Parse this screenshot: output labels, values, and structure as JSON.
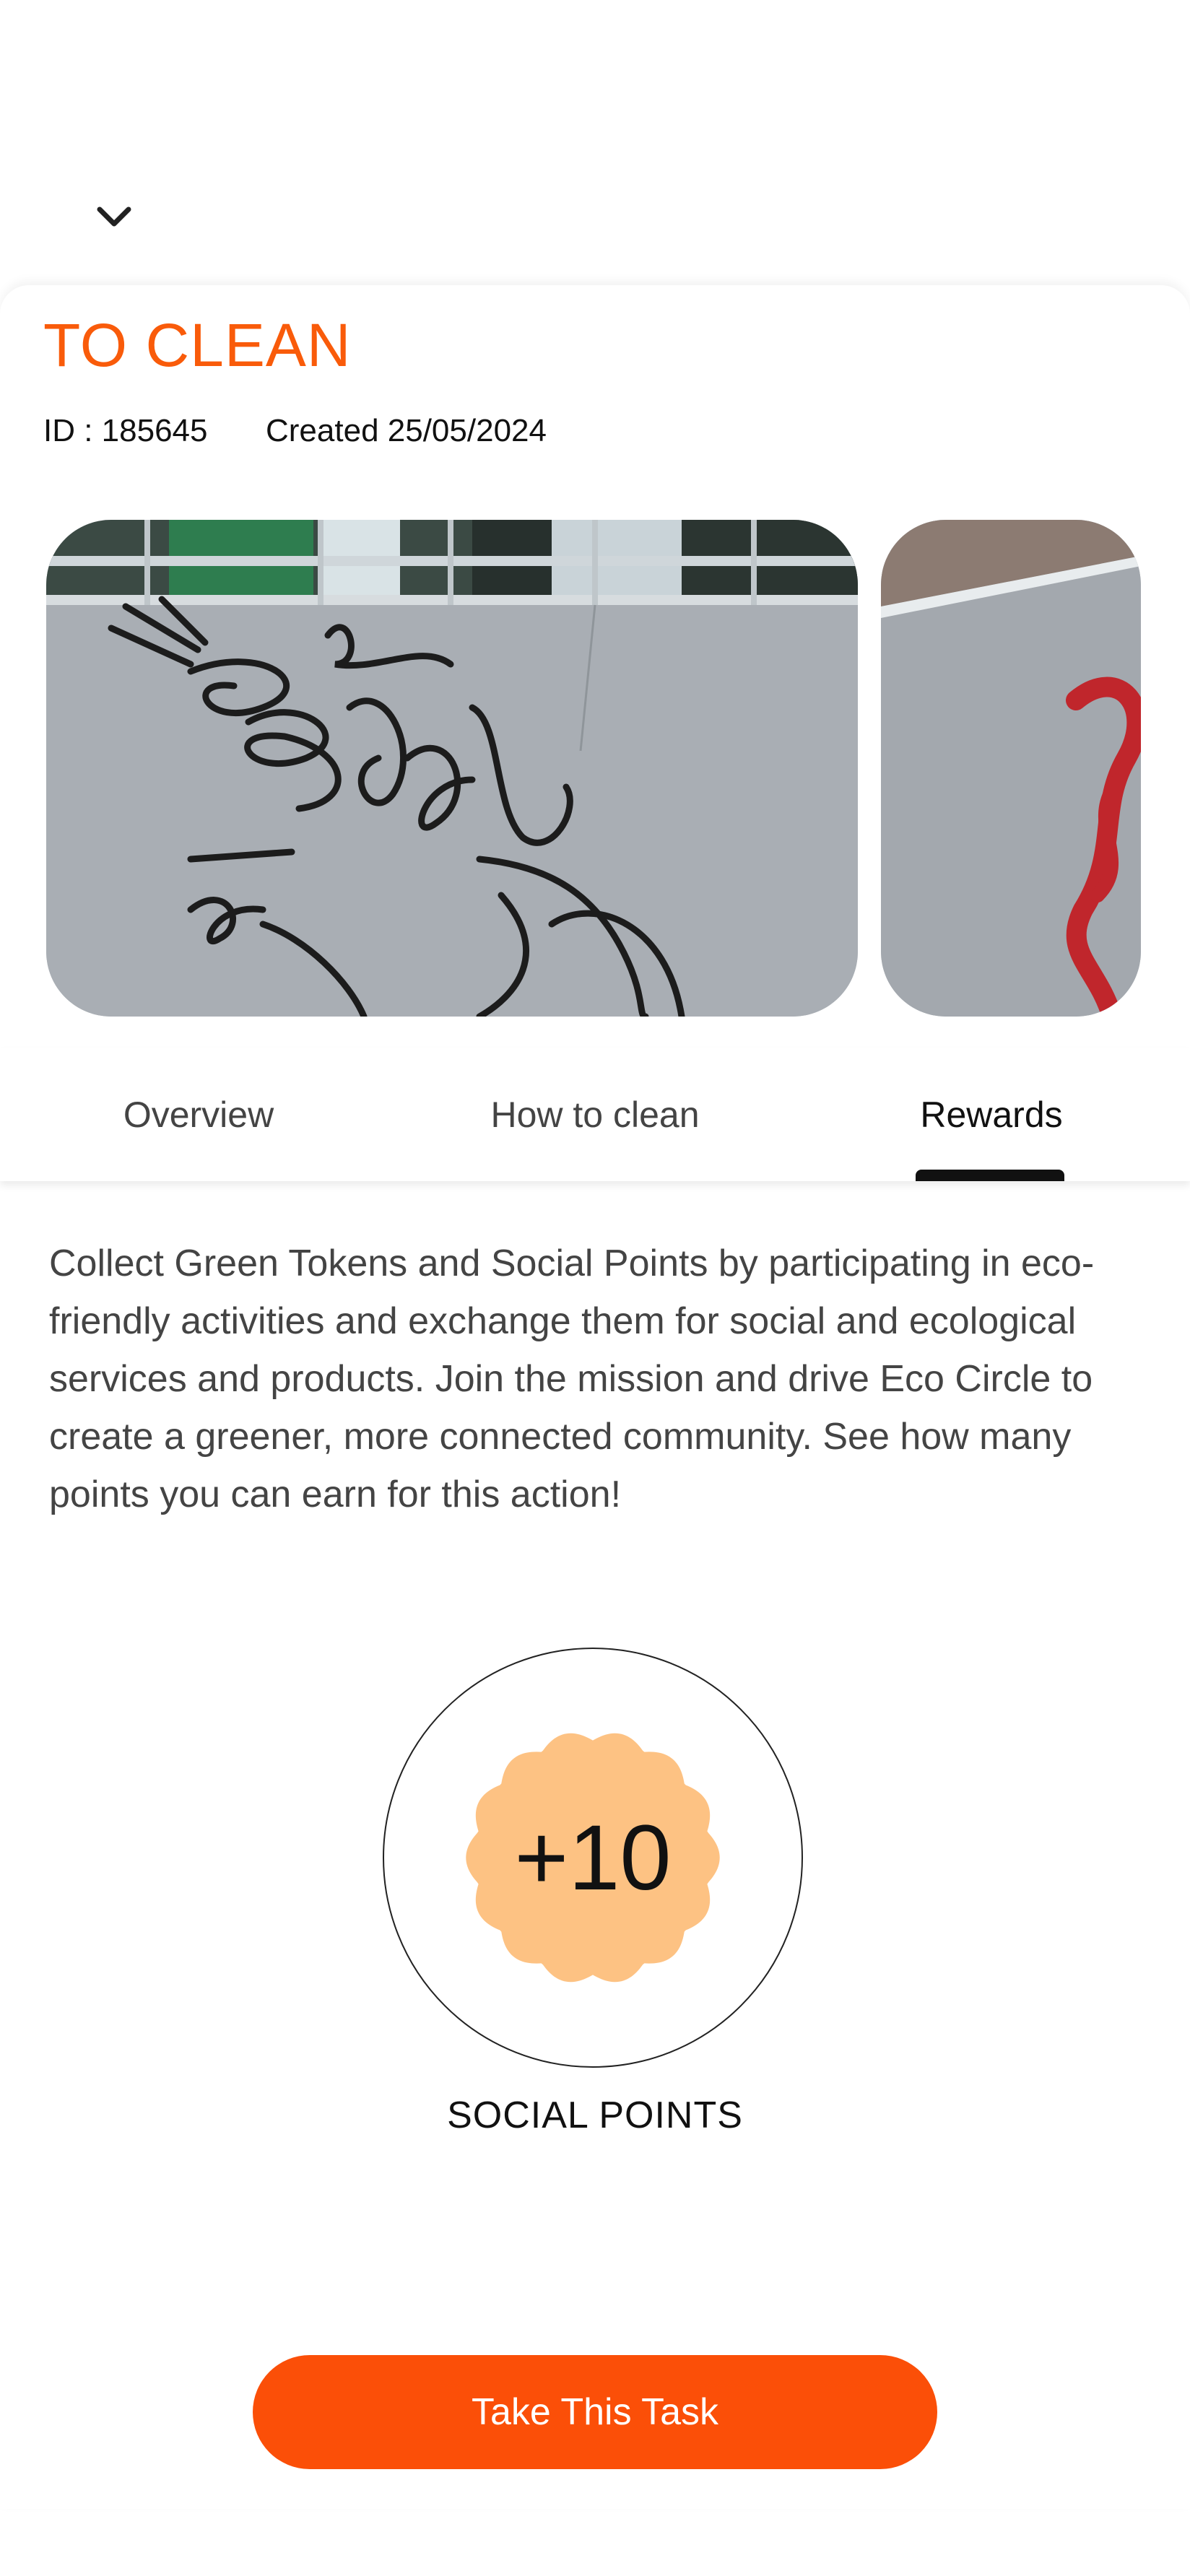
{
  "task": {
    "status_title": "TO CLEAN",
    "id_text": "ID : 185645",
    "created_text": "Created 25/05/2024"
  },
  "photos": [
    "graffiti-wall-black-tag",
    "graffiti-wall-red-tag"
  ],
  "tabs": [
    {
      "label": "Overview"
    },
    {
      "label": "How to clean"
    },
    {
      "label": "Rewards"
    }
  ],
  "active_tab": "Rewards",
  "rewards": {
    "description": "Collect Green Tokens and Social Points by participating in eco-friendly activities and exchange them for social and ecological services and products. Join the mission and drive Eco Circle to create a greener, more connected community. See how many points you can earn for this action!",
    "points_value": "+10",
    "points_label": "SOCIAL POINTS"
  },
  "cta": {
    "label": "Take This Task"
  },
  "colors": {
    "accent": "#f95b0a",
    "cta_background": "#fb4f08",
    "badge_fill": "#fdc283",
    "tab_indicator": "#111111"
  },
  "icons": {
    "collapse": "chevron-down-icon"
  }
}
